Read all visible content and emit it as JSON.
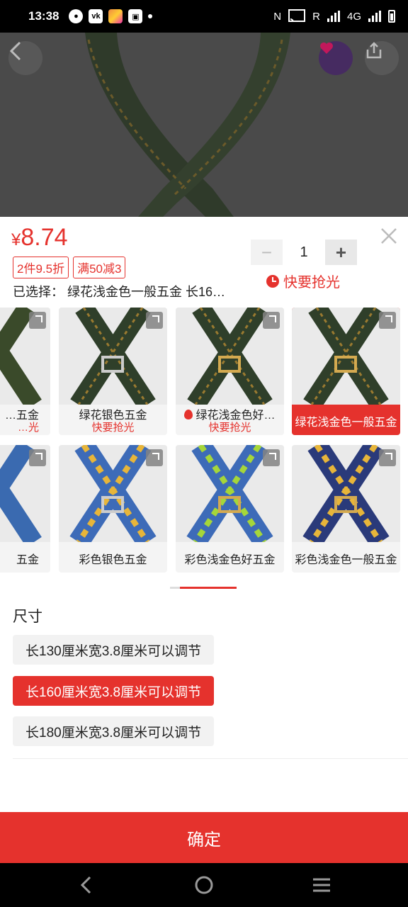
{
  "status_bar": {
    "time": "13:38",
    "network": "R",
    "network_type": "4G",
    "icons": [
      "message-icon",
      "vk-icon",
      "app-icon",
      "photo-icon",
      "dot-icon",
      "nfc-icon",
      "cast-icon",
      "signal-icon",
      "battery-icon"
    ]
  },
  "product": {
    "price_symbol": "¥",
    "price": "8.74",
    "tags": [
      "2件9.5折",
      "满50减3"
    ],
    "quantity": "1",
    "hurry_label": "快要抢光",
    "selected_label": "已选择：",
    "selected_value": "绿花浅金色一般五金 长16…"
  },
  "variants_row1": [
    {
      "name": "…五金",
      "sub": "…光"
    },
    {
      "name": "绿花银色五金",
      "sub": "快要抢光"
    },
    {
      "name": "绿花浅金色好…",
      "sub": "快要抢光"
    },
    {
      "name": "绿花浅金色一般五金",
      "sub": ""
    }
  ],
  "variants_row2": [
    {
      "name": "五金"
    },
    {
      "name": "彩色银色五金"
    },
    {
      "name": "彩色浅金色好五金"
    },
    {
      "name": "彩色浅金色一般五金"
    }
  ],
  "size": {
    "title": "尺寸",
    "options": [
      "长130厘米宽3.8厘米可以调节",
      "长160厘米宽3.8厘米可以调节",
      "长180厘米宽3.8厘米可以调节"
    ],
    "selected_index": 1
  },
  "confirm_label": "确定",
  "colors": {
    "accent": "#e5322d"
  }
}
